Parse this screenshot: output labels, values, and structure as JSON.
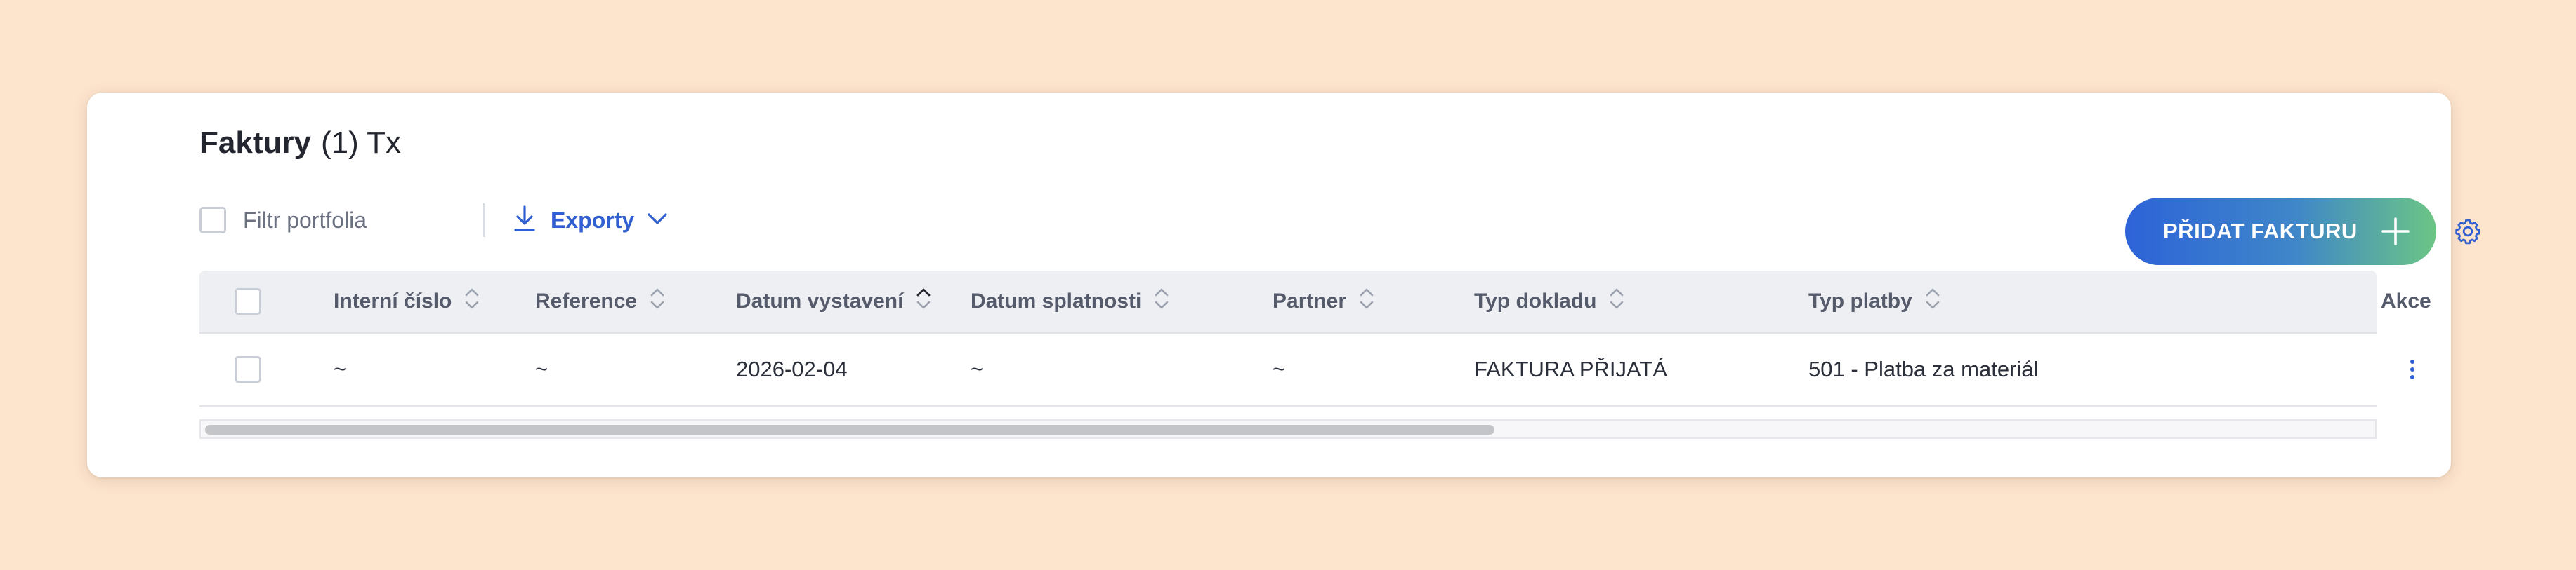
{
  "header": {
    "title": "Faktury",
    "count": "(1) Tx"
  },
  "toolbar": {
    "filter_label": "Filtr portfolia",
    "export_label": "Exporty",
    "add_button_label": "PŘIDAT FAKTURU"
  },
  "table": {
    "columns": [
      {
        "key": "interni_cislo",
        "label": "Interní číslo",
        "sort": "none"
      },
      {
        "key": "reference",
        "label": "Reference",
        "sort": "none"
      },
      {
        "key": "datum_vystaveni",
        "label": "Datum vystavení",
        "sort": "asc"
      },
      {
        "key": "datum_splatnosti",
        "label": "Datum splatnosti",
        "sort": "none"
      },
      {
        "key": "partner",
        "label": "Partner",
        "sort": "none"
      },
      {
        "key": "typ_dokladu",
        "label": "Typ dokladu",
        "sort": "none"
      },
      {
        "key": "typ_platby",
        "label": "Typ platby",
        "sort": "none"
      },
      {
        "key": "akce",
        "label": "Akce"
      }
    ],
    "rows": [
      {
        "interni_cislo": "~",
        "reference": "~",
        "datum_vystaveni": "2026-02-04",
        "datum_splatnosti": "~",
        "partner": "~",
        "typ_dokladu": "FAKTURA PŘIJATÁ",
        "typ_platby": "501 - Platba za materiál"
      }
    ]
  },
  "icons": {
    "download": "download-icon",
    "chevron": "chevron-down-icon",
    "plus": "plus-icon",
    "settings": "gear-icon",
    "sort": "sort-icon",
    "row_menu": "more-vertical-icon"
  },
  "colors": {
    "background": "#fde4cd",
    "accent_blue": "#2f5fd0",
    "button_gradient_start": "#2d63d8",
    "button_gradient_end": "#6cc585"
  }
}
